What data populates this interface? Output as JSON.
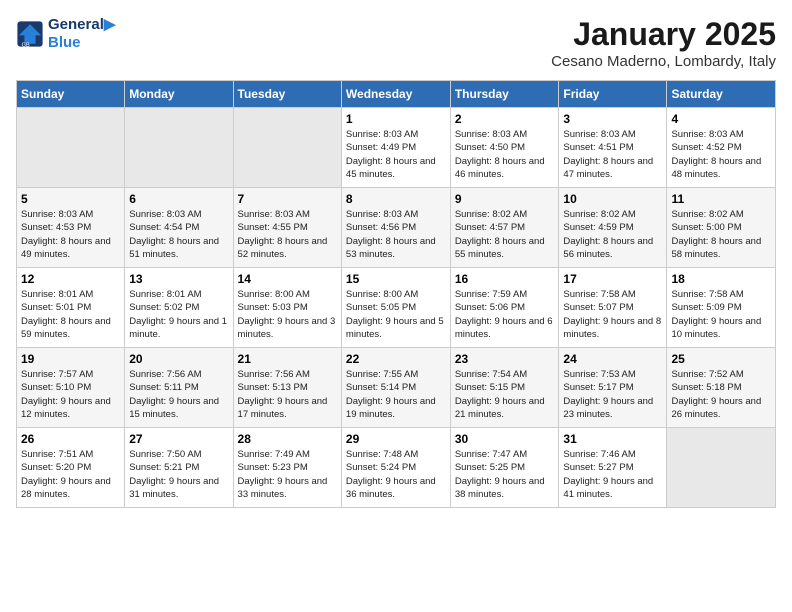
{
  "logo": {
    "line1": "General",
    "line2": "Blue"
  },
  "title": "January 2025",
  "location": "Cesano Maderno, Lombardy, Italy",
  "headers": [
    "Sunday",
    "Monday",
    "Tuesday",
    "Wednesday",
    "Thursday",
    "Friday",
    "Saturday"
  ],
  "weeks": [
    [
      {
        "day": "",
        "empty": true
      },
      {
        "day": "",
        "empty": true
      },
      {
        "day": "",
        "empty": true
      },
      {
        "day": "1",
        "sunrise": "8:03 AM",
        "sunset": "4:49 PM",
        "daylight": "8 hours and 45 minutes."
      },
      {
        "day": "2",
        "sunrise": "8:03 AM",
        "sunset": "4:50 PM",
        "daylight": "8 hours and 46 minutes."
      },
      {
        "day": "3",
        "sunrise": "8:03 AM",
        "sunset": "4:51 PM",
        "daylight": "8 hours and 47 minutes."
      },
      {
        "day": "4",
        "sunrise": "8:03 AM",
        "sunset": "4:52 PM",
        "daylight": "8 hours and 48 minutes."
      }
    ],
    [
      {
        "day": "5",
        "sunrise": "8:03 AM",
        "sunset": "4:53 PM",
        "daylight": "8 hours and 49 minutes."
      },
      {
        "day": "6",
        "sunrise": "8:03 AM",
        "sunset": "4:54 PM",
        "daylight": "8 hours and 51 minutes."
      },
      {
        "day": "7",
        "sunrise": "8:03 AM",
        "sunset": "4:55 PM",
        "daylight": "8 hours and 52 minutes."
      },
      {
        "day": "8",
        "sunrise": "8:03 AM",
        "sunset": "4:56 PM",
        "daylight": "8 hours and 53 minutes."
      },
      {
        "day": "9",
        "sunrise": "8:02 AM",
        "sunset": "4:57 PM",
        "daylight": "8 hours and 55 minutes."
      },
      {
        "day": "10",
        "sunrise": "8:02 AM",
        "sunset": "4:59 PM",
        "daylight": "8 hours and 56 minutes."
      },
      {
        "day": "11",
        "sunrise": "8:02 AM",
        "sunset": "5:00 PM",
        "daylight": "8 hours and 58 minutes."
      }
    ],
    [
      {
        "day": "12",
        "sunrise": "8:01 AM",
        "sunset": "5:01 PM",
        "daylight": "8 hours and 59 minutes."
      },
      {
        "day": "13",
        "sunrise": "8:01 AM",
        "sunset": "5:02 PM",
        "daylight": "9 hours and 1 minute."
      },
      {
        "day": "14",
        "sunrise": "8:00 AM",
        "sunset": "5:03 PM",
        "daylight": "9 hours and 3 minutes."
      },
      {
        "day": "15",
        "sunrise": "8:00 AM",
        "sunset": "5:05 PM",
        "daylight": "9 hours and 5 minutes."
      },
      {
        "day": "16",
        "sunrise": "7:59 AM",
        "sunset": "5:06 PM",
        "daylight": "9 hours and 6 minutes."
      },
      {
        "day": "17",
        "sunrise": "7:58 AM",
        "sunset": "5:07 PM",
        "daylight": "9 hours and 8 minutes."
      },
      {
        "day": "18",
        "sunrise": "7:58 AM",
        "sunset": "5:09 PM",
        "daylight": "9 hours and 10 minutes."
      }
    ],
    [
      {
        "day": "19",
        "sunrise": "7:57 AM",
        "sunset": "5:10 PM",
        "daylight": "9 hours and 12 minutes."
      },
      {
        "day": "20",
        "sunrise": "7:56 AM",
        "sunset": "5:11 PM",
        "daylight": "9 hours and 15 minutes."
      },
      {
        "day": "21",
        "sunrise": "7:56 AM",
        "sunset": "5:13 PM",
        "daylight": "9 hours and 17 minutes."
      },
      {
        "day": "22",
        "sunrise": "7:55 AM",
        "sunset": "5:14 PM",
        "daylight": "9 hours and 19 minutes."
      },
      {
        "day": "23",
        "sunrise": "7:54 AM",
        "sunset": "5:15 PM",
        "daylight": "9 hours and 21 minutes."
      },
      {
        "day": "24",
        "sunrise": "7:53 AM",
        "sunset": "5:17 PM",
        "daylight": "9 hours and 23 minutes."
      },
      {
        "day": "25",
        "sunrise": "7:52 AM",
        "sunset": "5:18 PM",
        "daylight": "9 hours and 26 minutes."
      }
    ],
    [
      {
        "day": "26",
        "sunrise": "7:51 AM",
        "sunset": "5:20 PM",
        "daylight": "9 hours and 28 minutes."
      },
      {
        "day": "27",
        "sunrise": "7:50 AM",
        "sunset": "5:21 PM",
        "daylight": "9 hours and 31 minutes."
      },
      {
        "day": "28",
        "sunrise": "7:49 AM",
        "sunset": "5:23 PM",
        "daylight": "9 hours and 33 minutes."
      },
      {
        "day": "29",
        "sunrise": "7:48 AM",
        "sunset": "5:24 PM",
        "daylight": "9 hours and 36 minutes."
      },
      {
        "day": "30",
        "sunrise": "7:47 AM",
        "sunset": "5:25 PM",
        "daylight": "9 hours and 38 minutes."
      },
      {
        "day": "31",
        "sunrise": "7:46 AM",
        "sunset": "5:27 PM",
        "daylight": "9 hours and 41 minutes."
      },
      {
        "day": "",
        "empty": true
      }
    ]
  ]
}
